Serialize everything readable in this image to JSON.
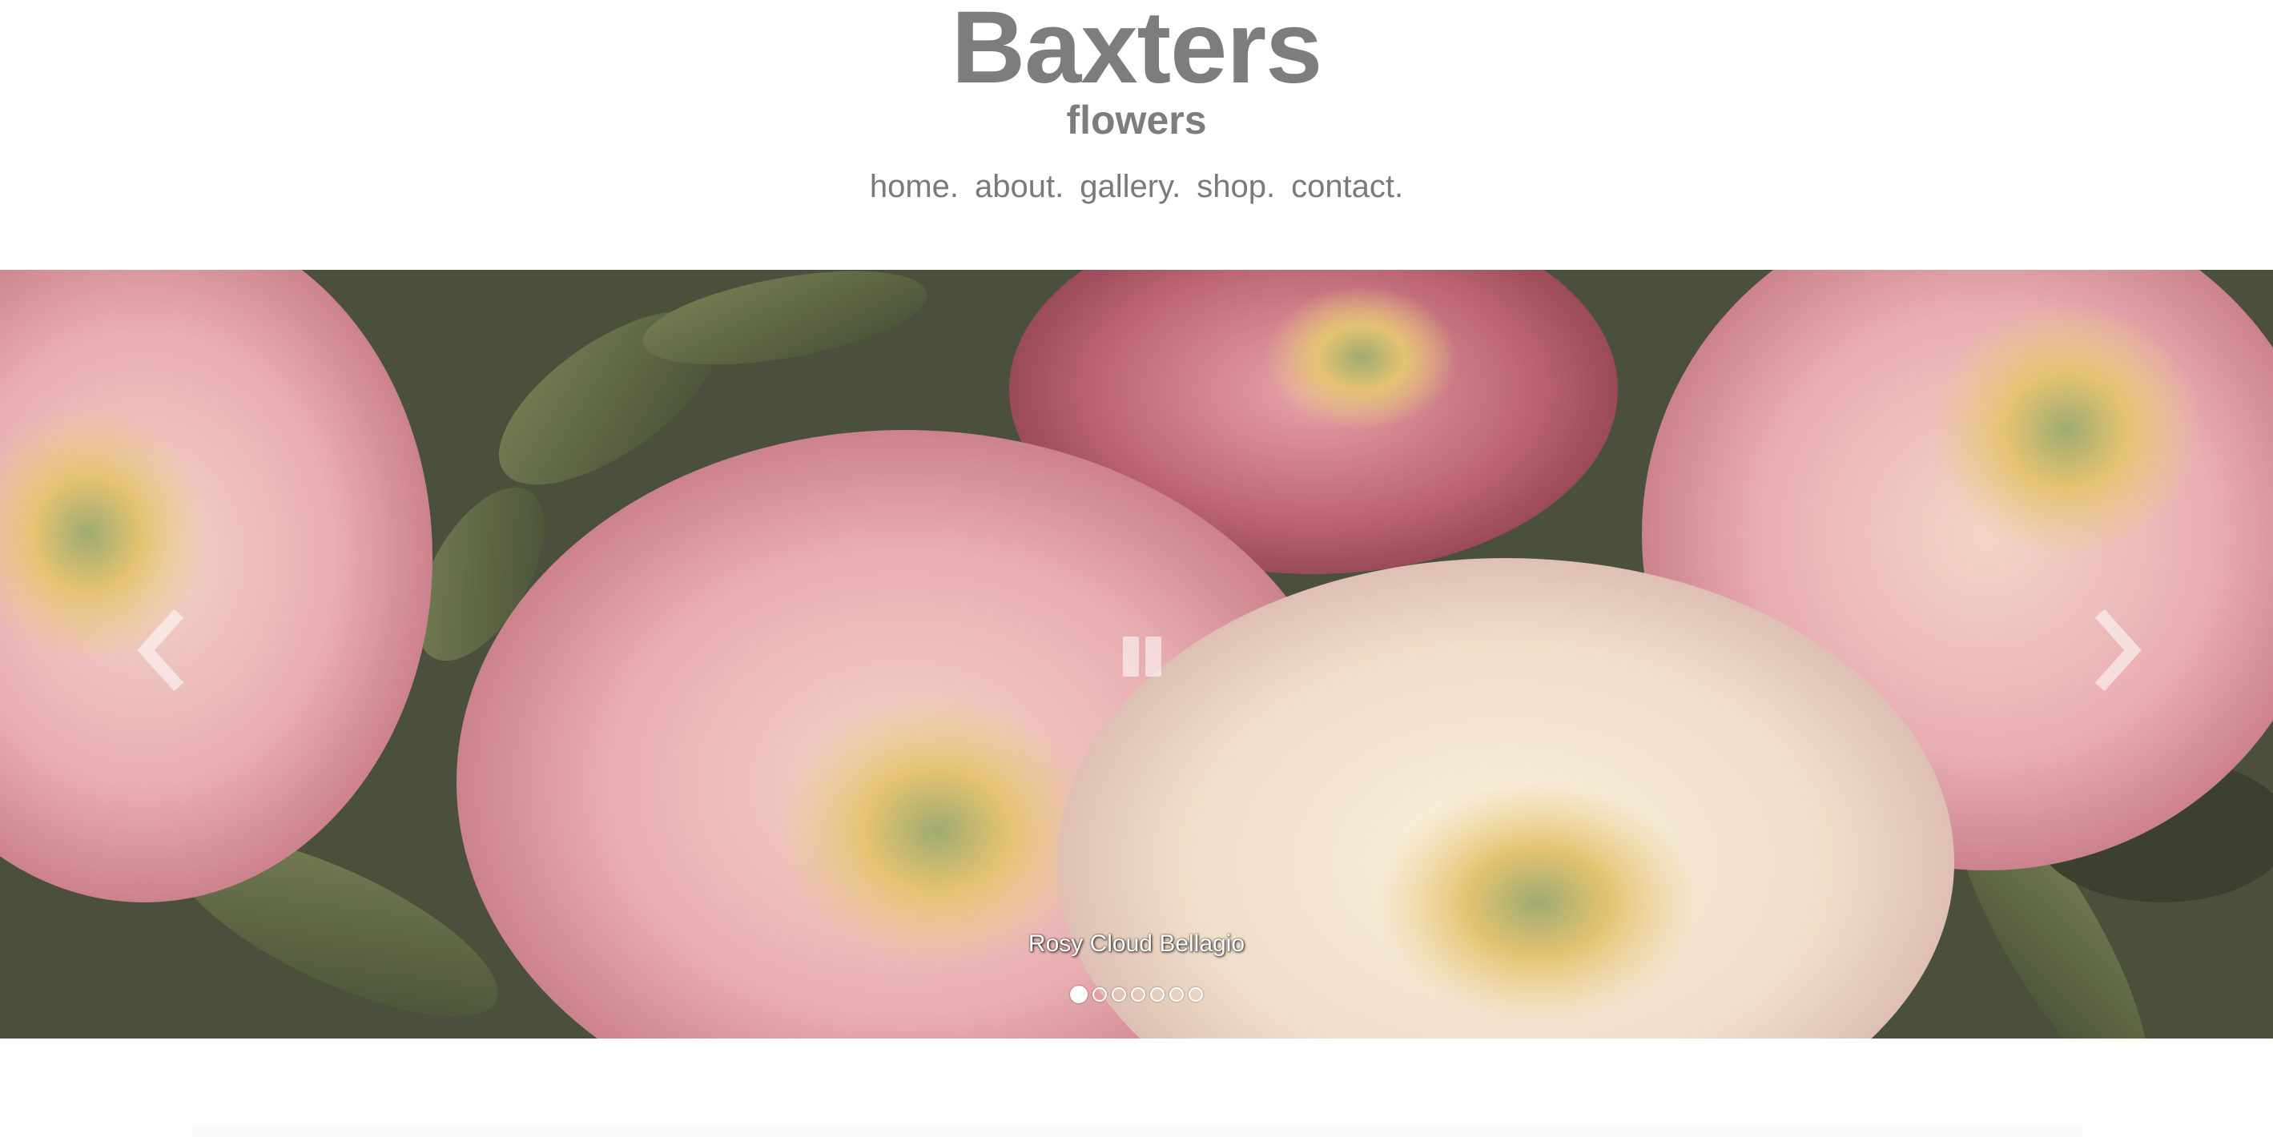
{
  "site": {
    "title": "Baxters",
    "subtitle": "flowers"
  },
  "nav": {
    "items": [
      "home.",
      "about.",
      "gallery.",
      "shop.",
      "contact."
    ]
  },
  "slider": {
    "caption": "Rosy Cloud Bellagio",
    "current_slide": 1,
    "slide_count": 7,
    "prev_icon": "chevron-left-icon",
    "next_icon": "chevron-right-icon",
    "pause_icon": "pause-icon"
  },
  "colors": {
    "text_gray": "#7d7d7d",
    "nav_gray": "#7a7a7a",
    "caption_white": "#ffffff"
  }
}
